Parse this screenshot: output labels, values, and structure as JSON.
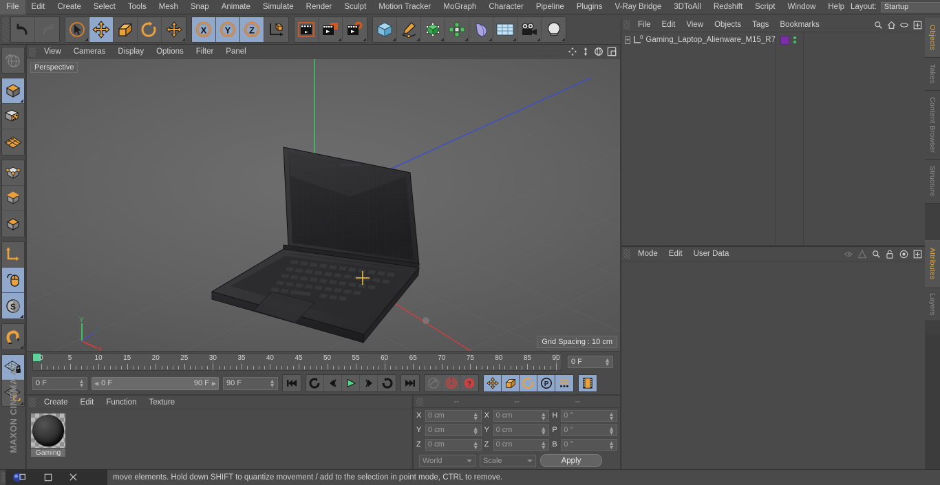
{
  "menubar": {
    "items": [
      "File",
      "Edit",
      "Create",
      "Select",
      "Tools",
      "Mesh",
      "Snap",
      "Animate",
      "Simulate",
      "Render",
      "Sculpt",
      "Motion Tracker",
      "MoGraph",
      "Character",
      "Pipeline",
      "Plugins",
      "V-Ray Bridge",
      "3DToAll",
      "Redshift",
      "Script",
      "Window",
      "Help"
    ],
    "layout_label": "Layout:",
    "layout_value": "Startup",
    "search_icon": "search-icon"
  },
  "toolbar": {
    "groups": [
      {
        "name": "history",
        "buttons": [
          {
            "icon": "undo-icon",
            "state": "normal"
          },
          {
            "icon": "redo-icon",
            "state": "disabled"
          }
        ]
      },
      {
        "name": "transform",
        "buttons": [
          {
            "icon": "live-selection-icon",
            "state": "normal"
          },
          {
            "icon": "move-icon",
            "state": "selected"
          },
          {
            "icon": "scale-icon",
            "state": "normal"
          },
          {
            "icon": "rotate-icon",
            "state": "normal"
          },
          {
            "icon": "move-alt-icon",
            "state": "normal"
          }
        ]
      },
      {
        "name": "axis-locks",
        "buttons": [
          {
            "icon": "x-axis-icon",
            "state": "selected"
          },
          {
            "icon": "y-axis-icon",
            "state": "selected"
          },
          {
            "icon": "z-axis-icon",
            "state": "selected"
          },
          {
            "icon": "world-axis-icon",
            "state": "normal"
          }
        ]
      },
      {
        "name": "render",
        "buttons": [
          {
            "icon": "render-view-icon",
            "state": "normal"
          },
          {
            "icon": "render-region-icon",
            "state": "normal"
          },
          {
            "icon": "render-settings-icon",
            "state": "normal"
          }
        ]
      },
      {
        "name": "create",
        "buttons": [
          {
            "icon": "cube-primitive-icon",
            "state": "normal"
          },
          {
            "icon": "pen-spline-icon",
            "state": "normal"
          },
          {
            "icon": "generator-icon",
            "state": "normal"
          },
          {
            "icon": "array-icon",
            "state": "normal"
          },
          {
            "icon": "bend-deformer-icon",
            "state": "normal"
          },
          {
            "icon": "floor-environment-icon",
            "state": "normal"
          },
          {
            "icon": "camera-icon",
            "state": "normal"
          },
          {
            "icon": "light-icon",
            "state": "normal"
          }
        ]
      }
    ]
  },
  "left_toolbar": {
    "groups": [
      [
        {
          "icon": "undo-view-icon",
          "state": "disabled"
        }
      ],
      [
        {
          "icon": "model-mode-icon",
          "state": "selected"
        },
        {
          "icon": "texture-mode-icon",
          "state": "normal"
        },
        {
          "icon": "polygon-grid-icon",
          "state": "normal"
        }
      ],
      [
        {
          "icon": "point-mode-icon",
          "state": "normal"
        },
        {
          "icon": "edge-mode-icon",
          "state": "normal"
        },
        {
          "icon": "polygon-mode-icon",
          "state": "normal"
        }
      ],
      [
        {
          "icon": "axis-modify-icon",
          "state": "normal"
        },
        {
          "icon": "viewport-solo-icon",
          "state": "selected"
        },
        {
          "icon": "enable-snapping-icon",
          "state": "selected"
        }
      ],
      [
        {
          "icon": "magnet-icon",
          "state": "normal"
        }
      ],
      [
        {
          "icon": "workplane-lock-icon",
          "state": "selected"
        },
        {
          "icon": "workplane-rotate-icon",
          "state": "normal"
        }
      ]
    ],
    "brand": "MAXON CINEMA 4D"
  },
  "viewport": {
    "menu": [
      "View",
      "Cameras",
      "Display",
      "Options",
      "Filter",
      "Panel"
    ],
    "label": "Perspective",
    "grid_spacing": "Grid Spacing : 10 cm",
    "axis_labels": {
      "x": "X",
      "y": "Y",
      "z": "Z"
    },
    "corner_icons": [
      "pan-view-icon",
      "dolly-view-icon",
      "rotate-view-icon",
      "maximize-view-icon"
    ]
  },
  "timeline": {
    "ticks": [
      0,
      5,
      10,
      15,
      20,
      25,
      30,
      35,
      40,
      45,
      50,
      55,
      60,
      65,
      70,
      75,
      80,
      85,
      90
    ],
    "min": 0,
    "max": 90,
    "current_frame_field": "0 F",
    "playhead_frame": 0
  },
  "transport": {
    "current_frame": "0 F",
    "range_start": "0 F",
    "range_end": "90 F",
    "end_frame": "90 F",
    "buttons": [
      {
        "icon": "go-to-start-icon",
        "state": "normal"
      },
      {
        "icon": "play-backwards-loop-icon",
        "state": "normal"
      },
      {
        "icon": "previous-frame-icon",
        "state": "normal"
      },
      {
        "icon": "play-icon",
        "state": "normal"
      },
      {
        "icon": "next-frame-icon",
        "state": "normal"
      },
      {
        "icon": "loop-icon",
        "state": "normal"
      },
      {
        "icon": "go-to-end-icon",
        "state": "normal"
      },
      {
        "icon": "autokey-wrench-icon",
        "state": "disabled"
      },
      {
        "icon": "record-active-objects-icon",
        "state": "normal"
      },
      {
        "icon": "autokeying-icon",
        "state": "normal"
      },
      {
        "icon": "key-position-icon",
        "state": "selected"
      },
      {
        "icon": "key-scale-icon",
        "state": "selected"
      },
      {
        "icon": "key-rotation-icon",
        "state": "selected"
      },
      {
        "icon": "key-parameter-icon",
        "state": "selected"
      },
      {
        "icon": "key-pla-icon",
        "state": "selected"
      },
      {
        "icon": "timeline-filmstrip-icon",
        "state": "selected"
      }
    ]
  },
  "material_manager": {
    "menu": [
      "Create",
      "Edit",
      "Function",
      "Texture"
    ],
    "materials": [
      {
        "name": "Gaming",
        "thumb": "material-sphere-dark"
      }
    ]
  },
  "coordinates": {
    "header": [
      "--",
      "--",
      "--"
    ],
    "rows": [
      {
        "pos_label": "X",
        "pos_value": "0 cm",
        "size_label": "X",
        "size_value": "0 cm",
        "rot_label": "H",
        "rot_value": "0 °"
      },
      {
        "pos_label": "Y",
        "pos_value": "0 cm",
        "size_label": "Y",
        "size_value": "0 cm",
        "rot_label": "P",
        "rot_value": "0 °"
      },
      {
        "pos_label": "Z",
        "pos_value": "0 cm",
        "size_label": "Z",
        "size_value": "0 cm",
        "rot_label": "B",
        "rot_value": "0 °"
      }
    ],
    "system": "World",
    "mode": "Scale",
    "apply": "Apply"
  },
  "object_manager": {
    "menu": [
      "File",
      "Edit",
      "View",
      "Objects",
      "Tags",
      "Bookmarks"
    ],
    "icons": [
      "search-icon",
      "home-icon",
      "visibility-icon",
      "add-layer-icon"
    ],
    "objects": [
      {
        "name": "Gaming_Laptop_Alienware_M15_R7",
        "level_badge": "0",
        "expandable": true,
        "tag_color": "#7a2fa8"
      }
    ]
  },
  "attribute_manager": {
    "menu": [
      "Mode",
      "Edit",
      "User Data"
    ],
    "icons": [
      "prev-object-icon",
      "next-object-icon",
      "search-icon",
      "lock-icon",
      "target-icon",
      "add-tab-icon"
    ]
  },
  "right_tabs": {
    "upper": [
      {
        "label": "Objects",
        "active": true
      },
      {
        "label": "Takes",
        "active": false
      },
      {
        "label": "Content Browser",
        "active": false
      },
      {
        "label": "Structure",
        "active": false
      }
    ],
    "lower": [
      {
        "label": "Attributes",
        "active": true
      },
      {
        "label": "Layers",
        "active": false
      }
    ]
  },
  "statusbar": {
    "text": "move elements. Hold down SHIFT to quantize movement / add to the selection in point mode, CTRL to remove."
  },
  "taskbar": {
    "items": [
      "app-icon",
      "restore-window-icon",
      "minimize-window-icon",
      "close-window-icon"
    ]
  },
  "colors": {
    "accent_orange": "#e08a2a",
    "selection_blue": "#8fa8cc",
    "panel_bg": "#4a4a4a",
    "axis_x": "#d04040",
    "axis_y": "#49c46a",
    "axis_z": "#4060d0",
    "tag_purple": "#7a2fa8"
  }
}
